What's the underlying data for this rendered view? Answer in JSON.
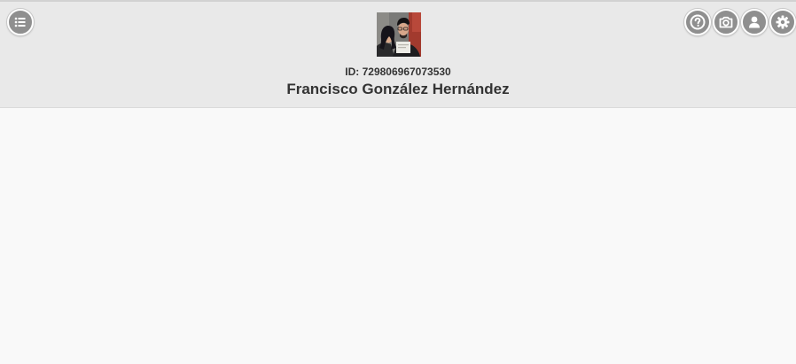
{
  "header": {
    "menu_icon": "list-icon",
    "actions": [
      {
        "name": "help",
        "icon": "question-icon"
      },
      {
        "name": "camera",
        "icon": "camera-icon"
      },
      {
        "name": "profile",
        "icon": "user-icon"
      },
      {
        "name": "settings",
        "icon": "gear-icon"
      }
    ],
    "background_color": "#e9e9e9",
    "button_color": "#8f8f8f"
  },
  "profile": {
    "id_label": "ID:",
    "id_value": "729806967073530",
    "name": "Francisco González Hernández"
  }
}
